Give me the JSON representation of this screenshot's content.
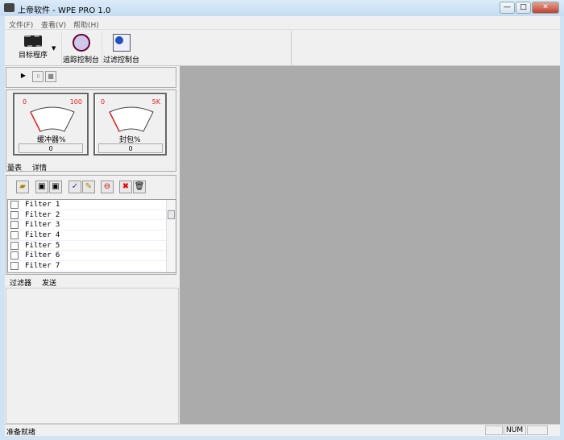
{
  "window": {
    "title": "上帝软件 - WPE PRO 1.0",
    "minimize": "—",
    "maximize": "□",
    "close": "✕"
  },
  "menu": [
    "文件(F)",
    "查看(V)",
    "帮助(H)"
  ],
  "toolbar": {
    "target": "目标程序",
    "trace": "追踪控制台",
    "filter": "过滤控制台"
  },
  "player": {
    "play": "▶",
    "pause": "॥",
    "stop": "■"
  },
  "gauges": [
    {
      "min": "0",
      "max": "100",
      "label": "缓冲器%",
      "value": "0"
    },
    {
      "min": "0",
      "max": "5K",
      "label": "封包%",
      "value": "0"
    }
  ],
  "gauge_tabs": [
    "量表",
    "详情"
  ],
  "filter_tools": [
    "open-folder-icon",
    "save-icon",
    "save-as-icon",
    "check-icon",
    "edit-icon",
    "stop-icon",
    "delete-icon",
    "trash-icon"
  ],
  "filters": [
    "Filter 1",
    "Filter 2",
    "Filter 3",
    "Filter 4",
    "Filter 5",
    "Filter 6",
    "Filter 7"
  ],
  "filter_tabs": [
    "过滤器",
    "发送"
  ],
  "status": {
    "text": "准备就绪",
    "num": "NUM"
  }
}
